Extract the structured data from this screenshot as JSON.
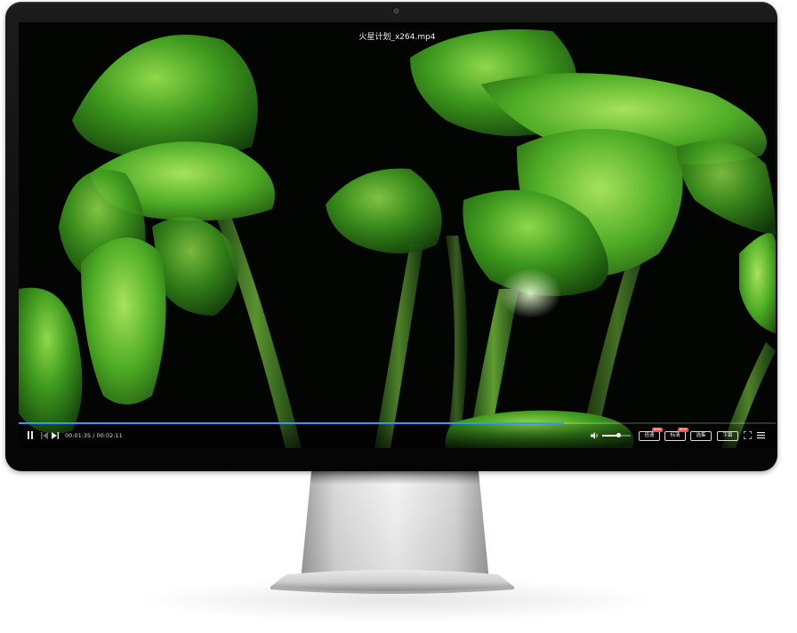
{
  "player": {
    "title": "火星计划_x264.mp4",
    "current_time": "00:01:35",
    "total_time": "00:02:11",
    "time_separator": " / ",
    "progress_fraction": 0.72,
    "volume_fraction": 0.55,
    "accent_color": "#2f9bff",
    "buttons": {
      "speed": {
        "label": "倍速",
        "badge": "NEW"
      },
      "quality": {
        "label": "标清",
        "badge": "NEW"
      },
      "playlist": {
        "label": "选集"
      },
      "subtitle": {
        "label": "字幕"
      }
    },
    "icons": {
      "pause": "pause-icon",
      "previous": "skip-previous-icon",
      "next": "skip-next-icon",
      "volume": "volume-icon",
      "fullscreen": "fullscreen-icon",
      "menu": "menu-icon"
    }
  },
  "colors": {
    "leaf_green": "#3f9a1e",
    "bezel": "#0c0c0c",
    "stand_silver": "#c9c9c9"
  }
}
